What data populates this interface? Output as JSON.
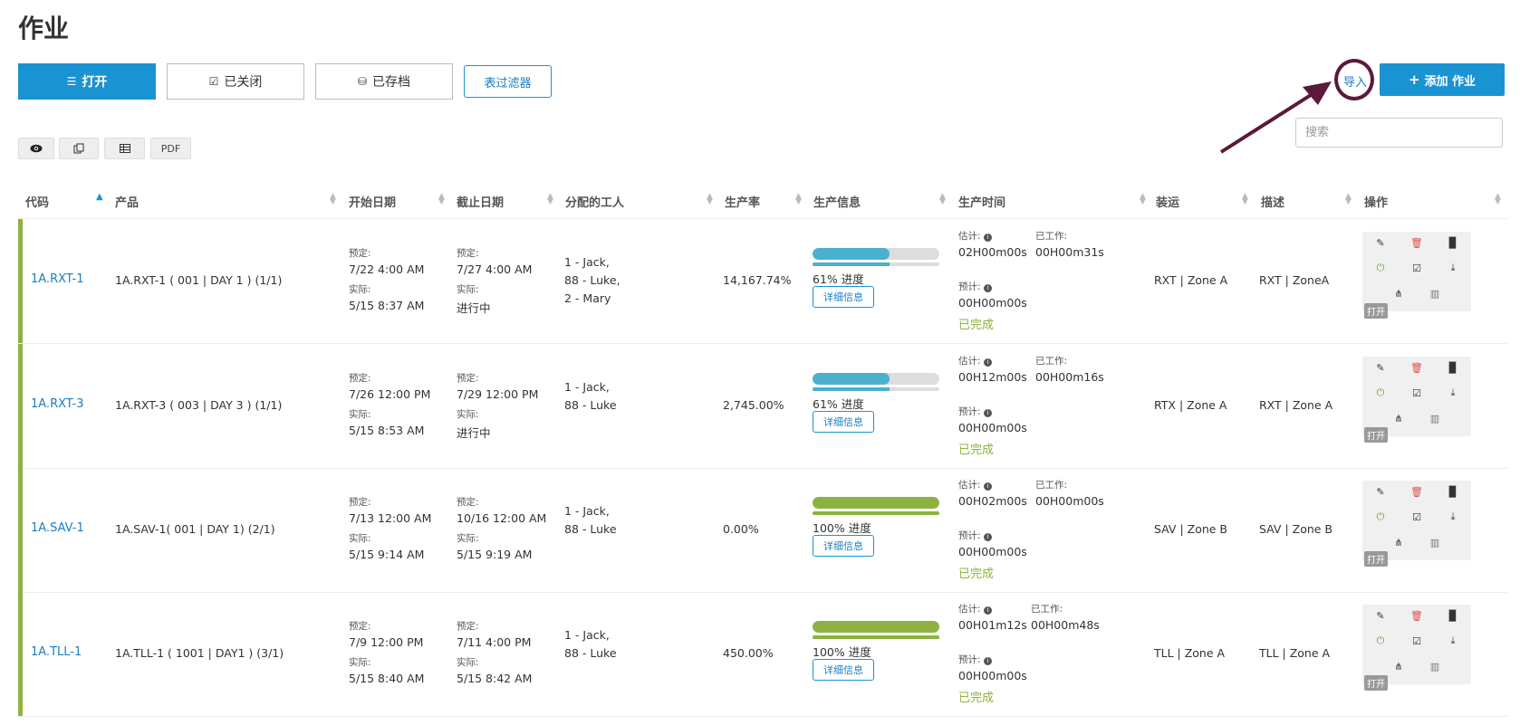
{
  "page": {
    "title": "作业"
  },
  "tabs": {
    "open": {
      "icon": "☰",
      "label": "打开"
    },
    "closed": {
      "icon": "☑",
      "label": "已关闭"
    },
    "archived": {
      "icon": "⛁",
      "label": "已存档"
    },
    "filter": {
      "label": "表过滤器"
    }
  },
  "toolbar": {
    "import_label": "导入",
    "add_icon": "+",
    "add_label": "添加 作业",
    "search_placeholder": "搜索",
    "pdf_label": "PDF"
  },
  "columns": [
    "代码",
    "产品",
    "开始日期",
    "截止日期",
    "分配的工人",
    "生产率",
    "生产信息",
    "生产时间",
    "装运",
    "描述",
    "操作"
  ],
  "labels": {
    "planned": "预定:",
    "actual": "实际:",
    "estimate": "估计:",
    "worked": "已工作:",
    "forecast": "预计:",
    "details": "详细信息",
    "open_badge": "打开"
  },
  "rows": [
    {
      "code": "1A.RXT-1",
      "product": "1A.RXT-1 ( 001 | DAY 1 ) (1/1)",
      "start_planned": "7/22   4:00 AM",
      "start_actual": "5/15   8:37 AM",
      "due_planned": "7/27   4:00 AM",
      "due_actual": "进行中",
      "workers": [
        "1 - Jack,",
        "88 - Luke,",
        "2 - Mary"
      ],
      "rate": "14,167.74%",
      "progress": 61,
      "progress_label": "61% 进度",
      "progress_color": "#4ab0d0",
      "estimate": "02H00m00s",
      "worked": "00H00m31s",
      "forecast": "00H00m00s",
      "status": "已完成",
      "shipping": "RXT | Zone A",
      "description": "RXT | ZoneA"
    },
    {
      "code": "1A.RXT-3",
      "product": "1A.RXT-3 ( 003 | DAY 3 ) (1/1)",
      "start_planned": "7/26   12:00 PM",
      "start_actual": "5/15   8:53 AM",
      "due_planned": "7/29   12:00 PM",
      "due_actual": "进行中",
      "workers": [
        "1 - Jack,",
        "88 - Luke"
      ],
      "rate": "2,745.00%",
      "progress": 61,
      "progress_label": "61% 进度",
      "progress_color": "#4ab0d0",
      "estimate": "00H12m00s",
      "worked": "00H00m16s",
      "forecast": "00H00m00s",
      "status": "已完成",
      "shipping": "RTX | Zone A",
      "description": "RXT | Zone A"
    },
    {
      "code": "1A.SAV-1",
      "product": "1A.SAV-1( 001 | DAY 1) (2/1)",
      "start_planned": "7/13   12:00 AM",
      "start_actual": "5/15   9:14 AM",
      "due_planned": "10/16   12:00 AM",
      "due_actual": "5/15   9:19 AM",
      "workers": [
        "1 - Jack,",
        "88 - Luke"
      ],
      "rate": "0.00%",
      "progress": 100,
      "progress_label": "100% 进度",
      "progress_color": "#8cb33f",
      "estimate": "00H02m00s",
      "worked": "00H00m00s",
      "forecast": "00H00m00s",
      "status": "已完成",
      "shipping": "SAV | Zone B",
      "description": "SAV | Zone B"
    },
    {
      "code": "1A.TLL-1",
      "product": "1A.TLL-1 ( 1001 | DAY1 ) (3/1)",
      "start_planned": "7/9   12:00 PM",
      "start_actual": "5/15   8:40 AM",
      "due_planned": "7/11   4:00 PM",
      "due_actual": "5/15   8:42 AM",
      "workers": [
        "1 - Jack,",
        "88 - Luke"
      ],
      "rate": "450.00%",
      "progress": 100,
      "progress_label": "100% 进度",
      "progress_color": "#8cb33f",
      "estimate": "00H01m12s",
      "worked": "00H00m48s",
      "forecast": "00H00m00s",
      "status": "已完成",
      "shipping": "TLL | Zone A",
      "description": "TLL | Zone A"
    }
  ],
  "colors": {
    "primary": "#1a93d3",
    "row_accent": "#8cb33f",
    "annotation": "#5a1a3a"
  }
}
